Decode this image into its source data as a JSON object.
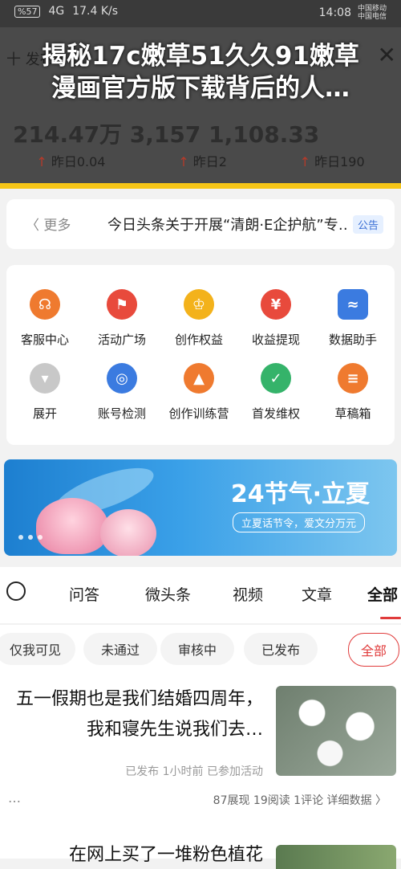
{
  "status_bar": {
    "left": "%57",
    "signal_hd": "4G",
    "speed": "17.4 K/s",
    "time": "14:08",
    "carrier_1": "中国移动",
    "carrier_2": "中国电信"
  },
  "header": {
    "back_label": "十 发布",
    "faded_text": "214.47万  3,157  1,108.33",
    "stat_1": "昨日190",
    "stat_2": "昨日2",
    "stat_3": "昨日0.04",
    "overlay_title_line1": "揭秘17c嫩草51久久91嫩草",
    "overlay_title_line2": "漫画官方版下载背后的人…"
  },
  "notice": {
    "badge": "公告",
    "text": "今日头条关于开展“清朗·E企护航”专…",
    "more": "更多"
  },
  "grid": {
    "items": [
      {
        "label": "数据助手",
        "icon": "chart-icon",
        "color": "#3b7be0",
        "glyph": "≈"
      },
      {
        "label": "收益提现",
        "icon": "yuan-icon",
        "color": "#e84a3c",
        "glyph": "¥"
      },
      {
        "label": "创作权益",
        "icon": "crown-icon",
        "color": "#f3b21b",
        "glyph": "♔"
      },
      {
        "label": "活动广场",
        "icon": "flag-icon",
        "color": "#e84a3c",
        "glyph": "⚑"
      },
      {
        "label": "客服中心",
        "icon": "headset-icon",
        "color": "#ef7a2f",
        "glyph": "☊"
      },
      {
        "label": "草稿箱",
        "icon": "draft-icon",
        "color": "#ef7a2f",
        "glyph": "≡"
      },
      {
        "label": "首发维权",
        "icon": "shield-icon",
        "color": "#35b36a",
        "glyph": "✓"
      },
      {
        "label": "创作训练营",
        "icon": "graduation-icon",
        "color": "#ef7a2f",
        "glyph": "▲"
      },
      {
        "label": "账号检测",
        "icon": "scan-icon",
        "color": "#3b7be0",
        "glyph": "◎"
      },
      {
        "label": "展开",
        "icon": "expand-icon",
        "color": "#c8c8c8",
        "glyph": "▾"
      }
    ]
  },
  "banner": {
    "title": "24节气·立夏",
    "subtitle": "立夏话节令，爱文分万元"
  },
  "tabs": {
    "items": [
      "全部",
      "文章",
      "视频",
      "微头条",
      "问答"
    ]
  },
  "chips": {
    "items": [
      "全部",
      "已发布",
      "审核中",
      "未通过",
      "仅我可见"
    ]
  },
  "feed": {
    "item1_title": "五一假期也是我们结婚四周年，我和寝先生说我们去…",
    "item1_meta": "已发布  1小时前  已参加活动",
    "item1_stats": "87展现  19阅读  1评论  详细数据 〉",
    "item1_more": "…",
    "item2_title": "在网上买了一堆粉色植花"
  }
}
